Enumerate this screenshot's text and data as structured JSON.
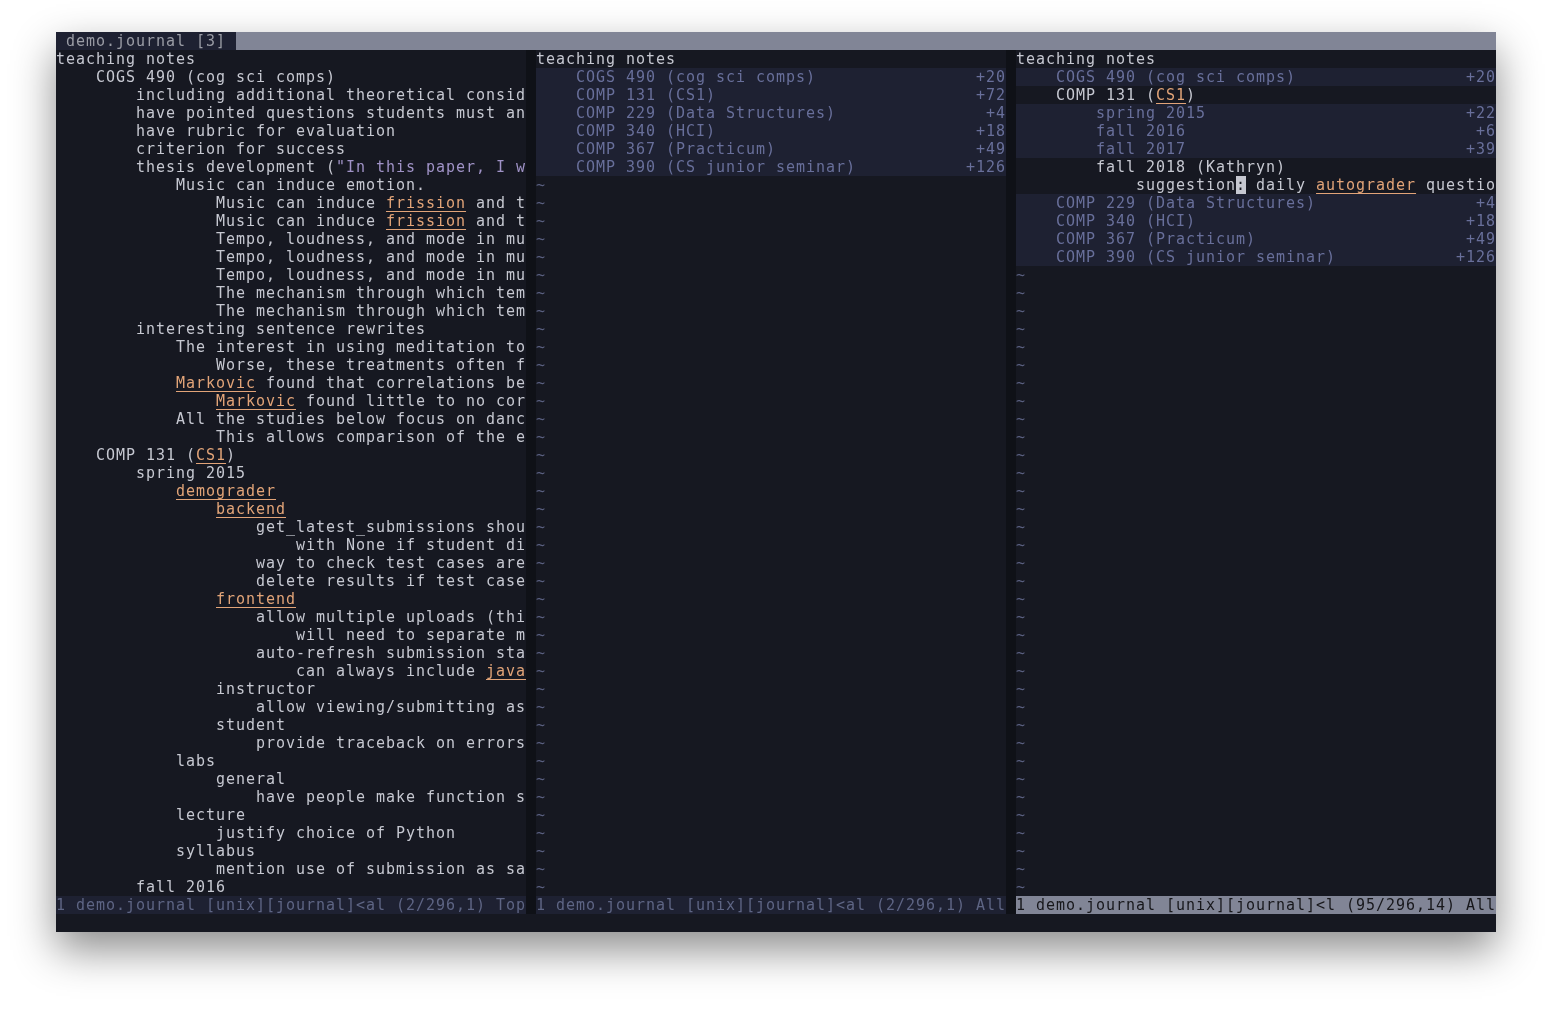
{
  "tab_line": {
    "tabs": [
      {
        "label": "demo.journal [3]",
        "selected": true
      }
    ]
  },
  "panes": [
    {
      "lines": [
        {
          "text": "teaching notes",
          "children": [
            {
              "text": "COGS 490 (cog sci comps)",
              "children": [
                {
                  "text": "including additional theoretical consid"
                },
                {
                  "text": "have pointed questions students must an"
                },
                {
                  "text": "have rubric for evaluation"
                },
                {
                  "text": "criterion for success"
                },
                {
                  "parts": [
                    {
                      "kind": "text",
                      "text": "thesis development ("
                    },
                    {
                      "kind": "quote",
                      "text": "\"In this paper, I w"
                    }
                  ],
                  "children": [
                    {
                      "text": "Music can induce emotion.",
                      "children": [
                        {
                          "parts": [
                            {
                              "kind": "text",
                              "text": "Music can induce "
                            },
                            {
                              "kind": "link",
                              "text": "frission"
                            },
                            {
                              "kind": "text",
                              "text": " and t"
                            }
                          ]
                        },
                        {
                          "parts": [
                            {
                              "kind": "text",
                              "text": "Music can induce "
                            },
                            {
                              "kind": "link",
                              "text": "frission"
                            },
                            {
                              "kind": "text",
                              "text": " and t"
                            }
                          ]
                        },
                        {
                          "text": "Tempo, loudness, and mode in mu"
                        },
                        {
                          "text": "Tempo, loudness, and mode in mu"
                        },
                        {
                          "text": "Tempo, loudness, and mode in mu"
                        },
                        {
                          "text": "The mechanism through which tem"
                        },
                        {
                          "text": "The mechanism through which tem"
                        }
                      ]
                    }
                  ]
                },
                {
                  "text": "interesting sentence rewrites",
                  "children": [
                    {
                      "text": "The interest in using meditation to",
                      "children": [
                        {
                          "text": "Worse, these treatments often f"
                        }
                      ]
                    },
                    {
                      "parts": [
                        {
                          "kind": "link",
                          "text": "Markovic"
                        },
                        {
                          "kind": "text",
                          "text": " found that correlations be"
                        }
                      ],
                      "children": [
                        {
                          "parts": [
                            {
                              "kind": "link",
                              "text": "Markovic"
                            },
                            {
                              "kind": "text",
                              "text": " found little to no cor"
                            }
                          ]
                        }
                      ]
                    },
                    {
                      "text": "All the studies below focus on danc",
                      "children": [
                        {
                          "text": "This allows comparison of the e"
                        }
                      ]
                    }
                  ]
                }
              ]
            },
            {
              "parts": [
                {
                  "kind": "text",
                  "text": "COMP 131 ("
                },
                {
                  "kind": "link",
                  "text": "CS1"
                },
                {
                  "kind": "text",
                  "text": ")"
                }
              ],
              "children": [
                {
                  "text": "spring 2015",
                  "children": [
                    {
                      "parts": [
                        {
                          "kind": "link",
                          "text": "demograder"
                        }
                      ],
                      "children": [
                        {
                          "parts": [
                            {
                              "kind": "link",
                              "text": "backend"
                            }
                          ],
                          "children": [
                            {
                              "text": "get_latest_submissions shou",
                              "children": [
                                {
                                  "text": "with None if student di"
                                }
                              ]
                            },
                            {
                              "text": "way to check test cases are"
                            },
                            {
                              "text": "delete results if test case"
                            }
                          ]
                        },
                        {
                          "parts": [
                            {
                              "kind": "link",
                              "text": "frontend"
                            }
                          ],
                          "children": [
                            {
                              "text": "allow multiple uploads (thi",
                              "children": [
                                {
                                  "text": "will need to separate m"
                                }
                              ]
                            },
                            {
                              "text": "auto-refresh submission sta",
                              "children": [
                                {
                                  "parts": [
                                    {
                                      "kind": "text",
                                      "text": "can always include "
                                    },
                                    {
                                      "kind": "link",
                                      "text": "java"
                                    }
                                  ]
                                }
                              ]
                            }
                          ]
                        },
                        {
                          "text": "instructor",
                          "children": [
                            {
                              "text": "allow viewing/submitting as"
                            }
                          ]
                        },
                        {
                          "text": "student",
                          "children": [
                            {
                              "text": "provide traceback on errors"
                            }
                          ]
                        }
                      ]
                    },
                    {
                      "text": "labs",
                      "children": [
                        {
                          "text": "general",
                          "children": [
                            {
                              "text": "have people make function s"
                            }
                          ]
                        }
                      ]
                    },
                    {
                      "text": "lecture",
                      "children": [
                        {
                          "text": "justify choice of Python"
                        }
                      ]
                    },
                    {
                      "text": "syllabus",
                      "children": [
                        {
                          "text": "mention use of submission as sa"
                        }
                      ]
                    }
                  ]
                },
                {
                  "text": "fall 2016"
                }
              ]
            }
          ]
        }
      ],
      "status": {
        "text": "1 demo.journal [unix][journal]<al (2/296,1) Top",
        "active": false
      }
    },
    {
      "lines": [
        {
          "text": "teaching notes",
          "folded": false,
          "children": [
            {
              "text": "COGS 490 (cog sci comps)",
              "folded": true,
              "fold_count": "+20"
            },
            {
              "text": "COMP 131 (CS1)",
              "folded": true,
              "fold_count": "+72"
            },
            {
              "text": "COMP 229 (Data Structures)",
              "folded": true,
              "fold_count": "+4"
            },
            {
              "text": "COMP 340 (HCI)",
              "folded": true,
              "fold_count": "+18"
            },
            {
              "text": "COMP 367 (Practicum)",
              "folded": true,
              "fold_count": "+49"
            },
            {
              "text": "COMP 390 (CS junior seminar)",
              "folded": true,
              "fold_count": "+126"
            }
          ]
        }
      ],
      "tildes": [
        "~",
        "~",
        "~",
        "~",
        "~",
        "~",
        "~",
        "~",
        "~",
        "~",
        "~",
        "~",
        "~",
        "~",
        "~",
        "~",
        "~",
        "~",
        "~",
        "~",
        "~",
        "~",
        "~",
        "~",
        "~",
        "~",
        "~",
        "~",
        "~",
        "~",
        "~",
        "~",
        "~",
        "~",
        "~",
        "~",
        "~",
        "~",
        "~",
        "~"
      ],
      "status": {
        "text": "1 demo.journal [unix][journal]<al (2/296,1) All",
        "active": false
      }
    },
    {
      "lines": [
        {
          "text": "teaching notes",
          "folded": false,
          "children": [
            {
              "text": "COGS 490 (cog sci comps)",
              "folded": true,
              "fold_count": "+20"
            },
            {
              "parts": [
                {
                  "kind": "text",
                  "text": "COMP 131 ("
                },
                {
                  "kind": "link",
                  "text": "CS1"
                },
                {
                  "kind": "text",
                  "text": ")"
                }
              ],
              "folded": false,
              "children": [
                {
                  "text": "spring 2015",
                  "folded": true,
                  "fold_count": "+22"
                },
                {
                  "text": "fall 2016",
                  "folded": true,
                  "fold_count": "+6"
                },
                {
                  "text": "fall 2017",
                  "folded": true,
                  "fold_count": "+39"
                },
                {
                  "text": "fall 2018 (Kathryn)",
                  "folded": false,
                  "children": [
                    {
                      "parts": [
                        {
                          "kind": "text",
                          "text": "suggestion"
                        },
                        {
                          "kind": "cursor",
                          "text": ":"
                        },
                        {
                          "kind": "text",
                          "text": " daily "
                        },
                        {
                          "kind": "link",
                          "text": "autograder"
                        },
                        {
                          "kind": "text",
                          "text": " questio"
                        }
                      ],
                      "folded": false
                    }
                  ]
                }
              ]
            },
            {
              "text": "COMP 229 (Data Structures)",
              "folded": true,
              "fold_count": "+4"
            },
            {
              "text": "COMP 340 (HCI)",
              "folded": true,
              "fold_count": "+18"
            },
            {
              "text": "COMP 367 (Practicum)",
              "folded": true,
              "fold_count": "+49"
            },
            {
              "text": "COMP 390 (CS junior seminar)",
              "folded": true,
              "fold_count": "+126"
            }
          ]
        }
      ],
      "tildes": [
        "~",
        "~",
        "~",
        "~",
        "~",
        "~",
        "~",
        "~",
        "~",
        "~",
        "~",
        "~",
        "~",
        "~",
        "~",
        "~",
        "~",
        "~",
        "~",
        "~",
        "~",
        "~",
        "~",
        "~",
        "~",
        "~",
        "~",
        "~",
        "~",
        "~",
        "~",
        "~",
        "~",
        "~",
        "~"
      ],
      "status": {
        "text": "1 demo.journal [unix][journal]<l (95/296,14) All",
        "active": true
      }
    }
  ]
}
